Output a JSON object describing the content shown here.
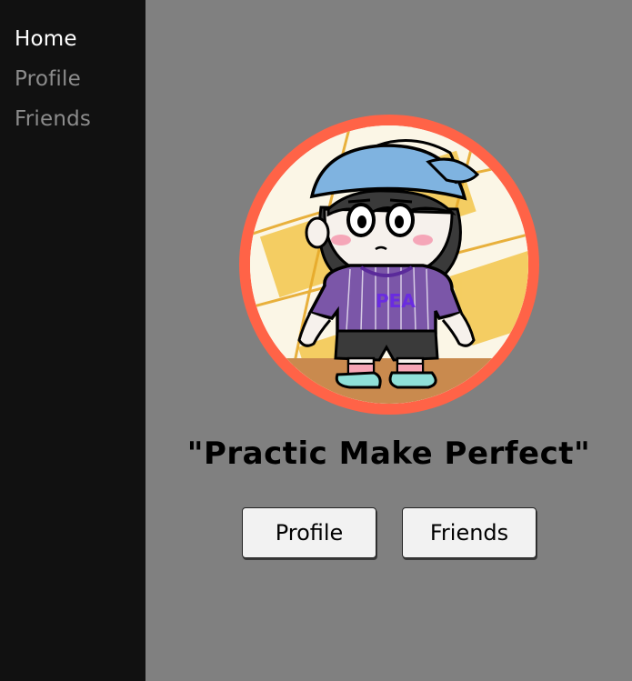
{
  "sidebar": {
    "items": [
      {
        "label": "Home",
        "active": true
      },
      {
        "label": "Profile",
        "active": false
      },
      {
        "label": "Friends",
        "active": false
      }
    ]
  },
  "main": {
    "avatar": {
      "icon": "cartoon-avatar-icon",
      "ring_color": "#ff6347"
    },
    "quote": "\"Practic Make Perfect\"",
    "buttons": {
      "profile_label": "Profile",
      "friends_label": "Friends"
    }
  },
  "colors": {
    "sidebar_bg": "#111111",
    "main_bg": "#808080",
    "nav_active": "#ffffff",
    "nav_inactive": "#8c8c8c",
    "shirt": "#7b56a8",
    "cap": "#7fb3e0"
  },
  "avatar_shirt_text": "PEA"
}
